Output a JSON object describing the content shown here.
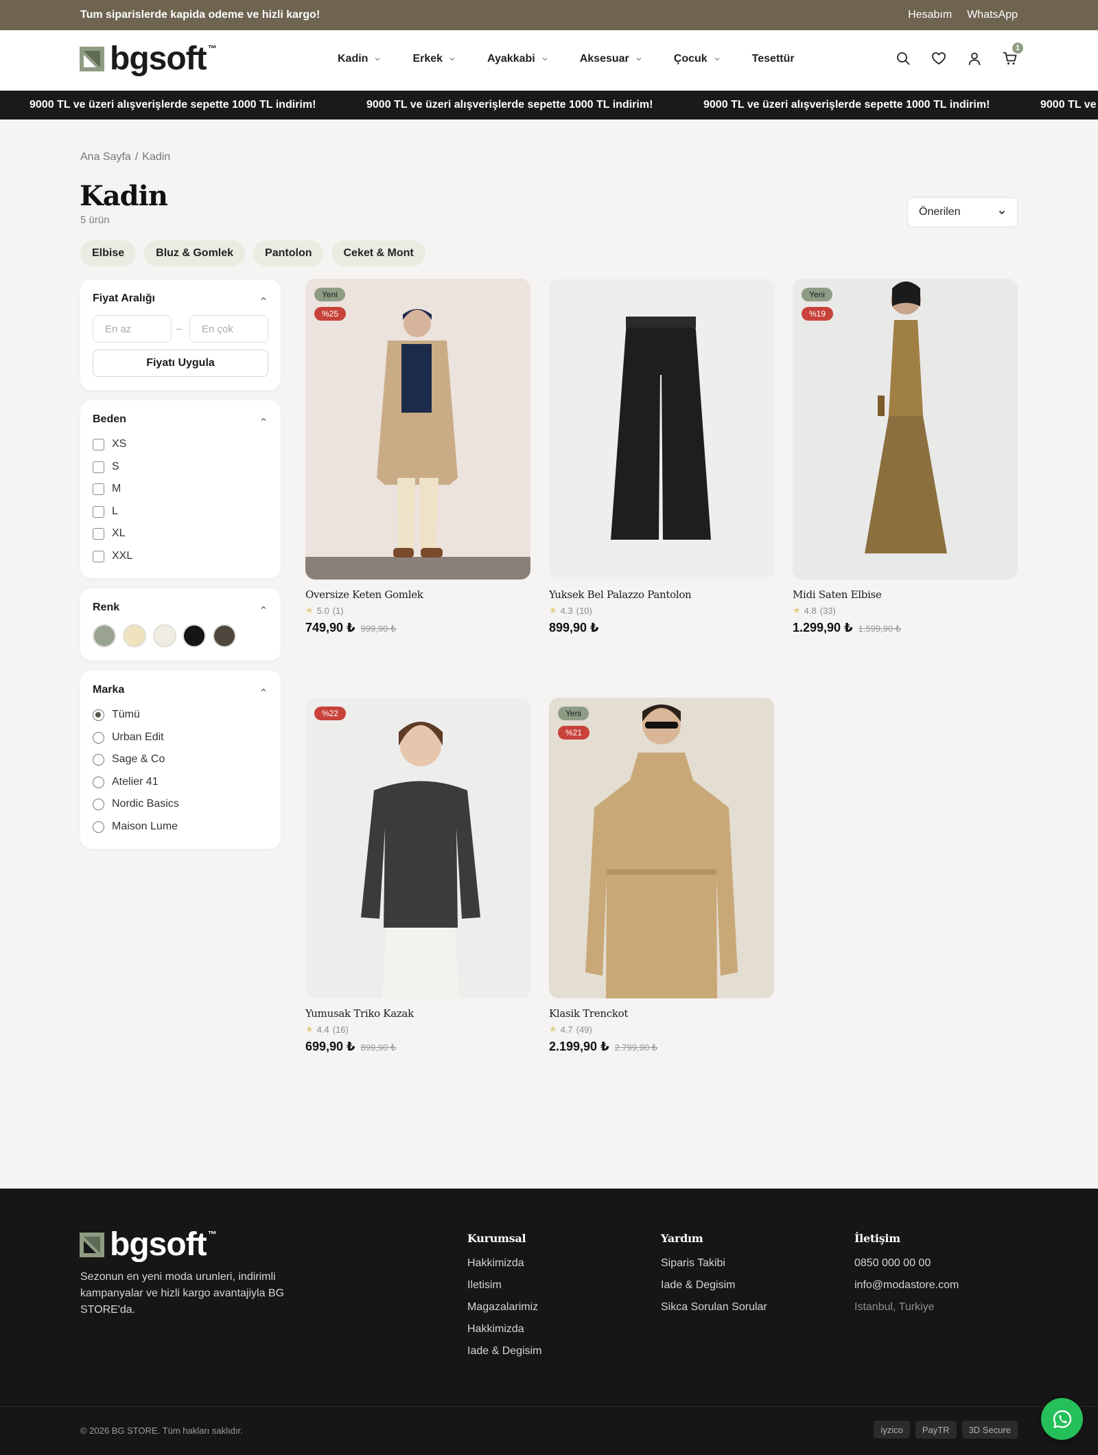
{
  "topbar": {
    "message": "Tum siparislerde kapida odeme ve hizli kargo!",
    "links": [
      "Hesabım",
      "WhatsApp"
    ]
  },
  "header": {
    "logo_text": "bgsoft",
    "logo_tm": "™",
    "nav": [
      {
        "label": "Kadin",
        "has_dropdown": true
      },
      {
        "label": "Erkek",
        "has_dropdown": true
      },
      {
        "label": "Ayakkabi",
        "has_dropdown": true
      },
      {
        "label": "Aksesuar",
        "has_dropdown": true
      },
      {
        "label": "Çocuk",
        "has_dropdown": true
      },
      {
        "label": "Tesettür",
        "has_dropdown": false
      }
    ],
    "icons": [
      "search-icon",
      "heart-icon",
      "user-icon",
      "cart-icon"
    ],
    "cart_count": "1"
  },
  "marquee": {
    "text": "9000 TL ve üzeri alışverişlerde sepette 1000 TL indirim!"
  },
  "breadcrumb": {
    "home": "Ana Sayfa",
    "separator": "/",
    "current": "Kadin"
  },
  "page": {
    "title": "Kadin",
    "count": "5 ürün",
    "sort_label": "Önerilen"
  },
  "chips": [
    "Elbise",
    "Bluz & Gomlek",
    "Pantolon",
    "Ceket & Mont"
  ],
  "filters": {
    "price": {
      "title": "Fiyat Aralığı",
      "min_placeholder": "En az",
      "max_placeholder": "En çok",
      "separator": "–",
      "apply": "Fiyatı Uygula"
    },
    "size": {
      "title": "Beden",
      "options": [
        "XS",
        "S",
        "M",
        "L",
        "XL",
        "XXL"
      ]
    },
    "color": {
      "title": "Renk",
      "swatches": [
        "#9aa392",
        "#efe3bf",
        "#efece4",
        "#151515",
        "#4f473e"
      ]
    },
    "brand": {
      "title": "Marka",
      "options": [
        "Tümü",
        "Urban Edit",
        "Sage & Co",
        "Atelier 41",
        "Nordic Basics",
        "Maison Lume"
      ],
      "selected": "Tümü"
    }
  },
  "products": [
    {
      "name": "Oversize Keten Gomlek",
      "rating": "5.0",
      "reviews": "(1)",
      "price": "749,90 ₺",
      "old_price": "999,90 ₺",
      "badges": [
        "Yeni",
        "%25"
      ]
    },
    {
      "name": "Yuksek Bel Palazzo Pantolon",
      "rating": "4.3",
      "reviews": "(10)",
      "price": "899,90 ₺",
      "old_price": "",
      "badges": []
    },
    {
      "name": "Midi Saten Elbise",
      "rating": "4.8",
      "reviews": "(33)",
      "price": "1.299,90 ₺",
      "old_price": "1.599,90 ₺",
      "badges": [
        "Yeni",
        "%19"
      ]
    },
    {
      "name": "Yumusak Triko Kazak",
      "rating": "4.4",
      "reviews": "(16)",
      "price": "699,90 ₺",
      "old_price": "899,90 ₺",
      "badges": [
        "%22"
      ]
    },
    {
      "name": "Klasik Trenckot",
      "rating": "4.7",
      "reviews": "(49)",
      "price": "2.199,90 ₺",
      "old_price": "2.799,90 ₺",
      "badges": [
        "Yeni",
        "%21"
      ]
    }
  ],
  "footer": {
    "logo_text": "bgsoft",
    "logo_tm": "™",
    "description": "Sezonun en yeni moda urunleri, indirimli kampanyalar ve hizli kargo avantajiyla BG STORE'da.",
    "columns": [
      {
        "title": "Kurumsal",
        "links": [
          "Hakkimizda",
          "Iletisim",
          "Magazalarimiz",
          "Hakkimizda",
          "Iade & Degisim"
        ]
      },
      {
        "title": "Yardım",
        "links": [
          "Siparis Takibi",
          "Iade & Degisim",
          "Sikca Sorulan Sorular"
        ]
      },
      {
        "title": "İletişim",
        "links": [
          "0850 000 00 00",
          "info@modastore.com",
          "Istanbul, Turkiye"
        ]
      }
    ],
    "copyright": "© 2026 BG STORE. Tüm hakları saklıdır.",
    "payments": [
      "iyzico",
      "PayTR",
      "3D Secure"
    ]
  },
  "colors": {
    "topbar": "#6e6450",
    "accent_sage": "#8e9c84",
    "discount": "#c7423a",
    "footer_bg": "#161616",
    "whatsapp": "#25c05a"
  }
}
